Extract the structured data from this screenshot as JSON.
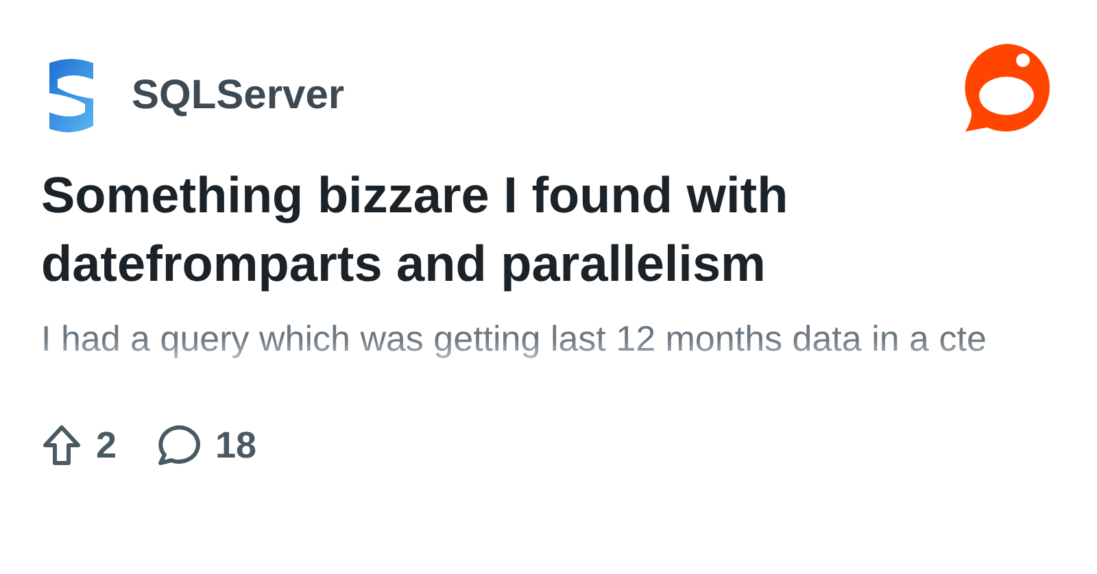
{
  "community": {
    "name": "SQLServer"
  },
  "post": {
    "title": "Something bizzare I found with datefromparts and parallelism",
    "body": "I had a query which was getting last 12 months data in a cte"
  },
  "stats": {
    "upvotes": "2",
    "comments": "18"
  }
}
